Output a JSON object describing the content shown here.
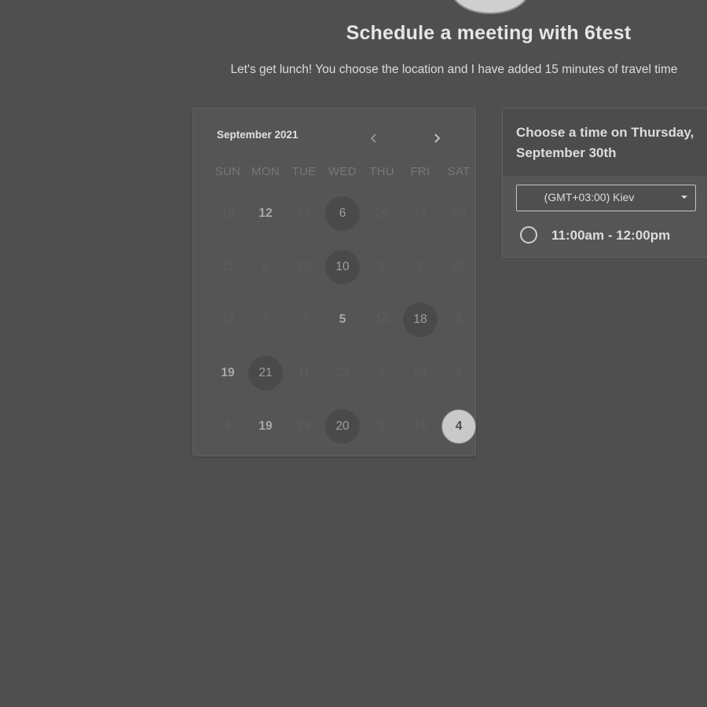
{
  "header": {
    "title": "Schedule a meeting with 6test",
    "subtitle": "Let's get lunch! You choose the location and I have added 15 minutes of travel time"
  },
  "calendar": {
    "month": "September 2021",
    "weekdays": [
      "SUN",
      "MON",
      "TUE",
      "WED",
      "THU",
      "FRI",
      "SAT"
    ],
    "weeks": [
      [
        {
          "d": "18"
        },
        {
          "d": "12",
          "s": "bold"
        },
        {
          "d": "14"
        },
        {
          "d": "6",
          "s": "avail"
        },
        {
          "d": "26"
        },
        {
          "d": "17"
        },
        {
          "d": "29"
        }
      ],
      [
        {
          "d": "11"
        },
        {
          "d": "6"
        },
        {
          "d": "20"
        },
        {
          "d": "10",
          "s": "avail"
        },
        {
          "d": "6"
        },
        {
          "d": "2"
        },
        {
          "d": "29"
        }
      ],
      [
        {
          "d": "13"
        },
        {
          "d": "7"
        },
        {
          "d": "7"
        },
        {
          "d": "5",
          "s": "bold"
        },
        {
          "d": "14"
        },
        {
          "d": "18",
          "s": "avail"
        },
        {
          "d": "1"
        }
      ],
      [
        {
          "d": "19",
          "s": "bold"
        },
        {
          "d": "21",
          "s": "avail"
        },
        {
          "d": "11"
        },
        {
          "d": "29"
        },
        {
          "d": "3"
        },
        {
          "d": "24"
        },
        {
          "d": "2"
        }
      ],
      [
        {
          "d": "4"
        },
        {
          "d": "19",
          "s": "bold"
        },
        {
          "d": "29"
        },
        {
          "d": "20",
          "s": "avail"
        },
        {
          "d": "9"
        },
        {
          "d": "16"
        },
        {
          "d": "4",
          "s": "selected"
        }
      ]
    ]
  },
  "panel": {
    "title": "Choose a time on Thursday, September 30th",
    "timezone": "(GMT+03:00) Kiev",
    "slots": [
      "11:00am - 12:00pm"
    ]
  },
  "colors": {
    "background": "#4f4f4f",
    "selected_day": "#c9c9c9",
    "available_day": "#4a4a4a"
  }
}
